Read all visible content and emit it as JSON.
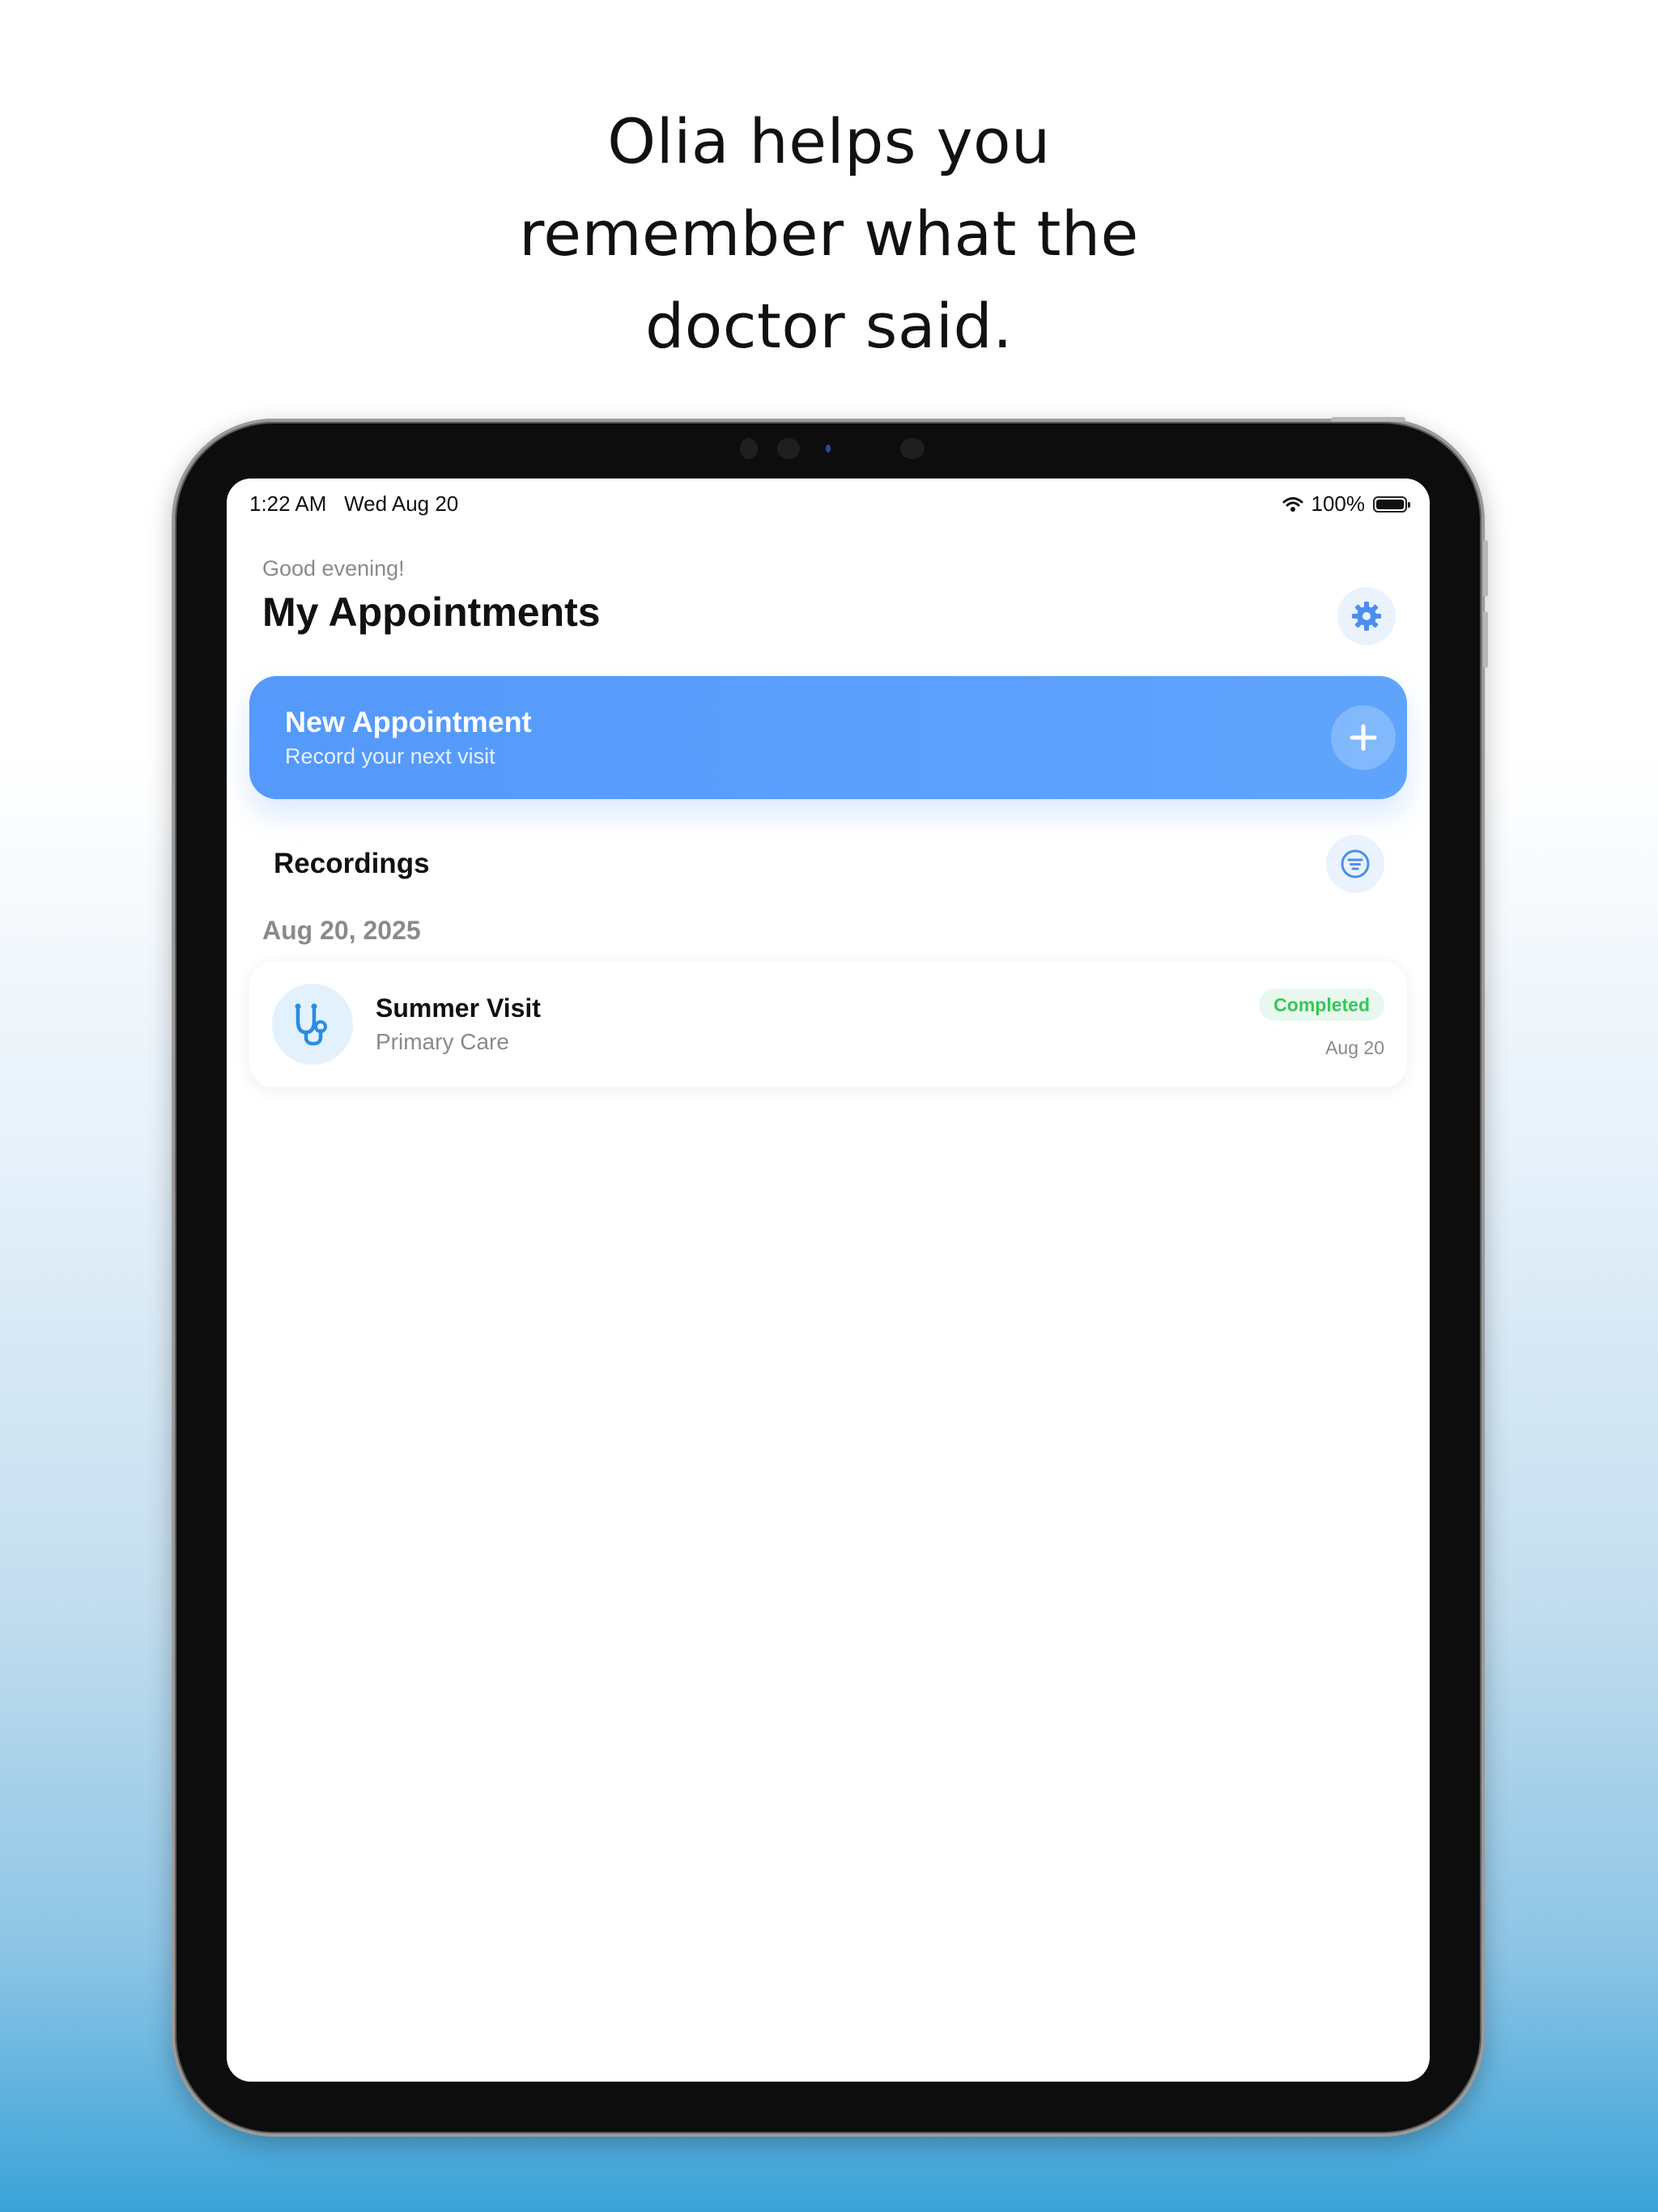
{
  "headline": {
    "line1": "Olia helps you",
    "line2": "remember what the",
    "line3": "doctor said."
  },
  "status_bar": {
    "time": "1:22 AM",
    "date": "Wed Aug 20",
    "battery": "100%"
  },
  "header": {
    "greeting": "Good evening!",
    "title": "My Appointments"
  },
  "new_appointment": {
    "title": "New Appointment",
    "subtitle": "Record your next visit"
  },
  "recordings": {
    "title": "Recordings",
    "groups": [
      {
        "date": "Aug 20, 2025",
        "items": [
          {
            "title": "Summer Visit",
            "subtitle": "Primary Care",
            "status": "Completed",
            "date": "Aug 20"
          }
        ]
      }
    ]
  },
  "colors": {
    "accent": "#5499fb",
    "completed": "#34c759",
    "icon_blue": "#2a8de0"
  },
  "icons": {
    "settings": "gear-icon",
    "add": "plus-icon",
    "filter": "filter-icon",
    "visit": "stethoscope-icon"
  }
}
